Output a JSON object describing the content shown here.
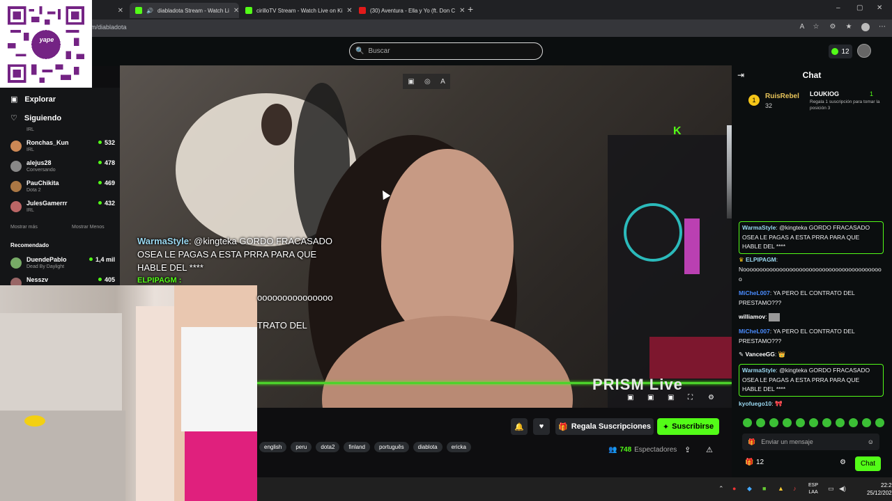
{
  "browser": {
    "tabs": [
      {
        "title": "diabladota Stream - Watch Li",
        "color": "#53fc18"
      },
      {
        "title": "cirilloTV Stream - Watch Live on Ki",
        "color": "#53fc18"
      },
      {
        "title": "(30) Aventura - Ella y Yo (ft. Don C",
        "color": "#e21a1a"
      }
    ],
    "partial_tab": "d",
    "new_tab": "+",
    "url": "m/diabladota",
    "window": {
      "minimize": "–",
      "maximize": "▢",
      "close": "✕"
    }
  },
  "header": {
    "search_placeholder": "Buscar",
    "notif_count": "12"
  },
  "qr": {
    "brand": "yape",
    "brand_color": "#742384"
  },
  "sidebar": {
    "nav": [
      {
        "label": "Explorar",
        "icon": "compass-icon"
      },
      {
        "label": "Siguiendo",
        "icon": "heart-icon"
      }
    ],
    "partial_sub": "IRL",
    "channels": [
      {
        "name": "Ronchas_Kun",
        "sub": "IRL",
        "viewers": "532",
        "color": "#c85"
      },
      {
        "name": "alejus28",
        "sub": "Conversando",
        "viewers": "478",
        "color": "#888"
      },
      {
        "name": "PauChikita",
        "sub": "Dota 2",
        "viewers": "469",
        "color": "#a74"
      },
      {
        "name": "JulesGamerrr",
        "sub": "IRL",
        "viewers": "432",
        "color": "#b66"
      }
    ],
    "show_more": "Mostrar más",
    "show_less": "Mostrar Menos",
    "recommended_heading": "Recomendado",
    "recommended": [
      {
        "name": "DuendePablo",
        "sub": "Dead By Daylight",
        "viewers": "1,4 mil",
        "color": "#7a6"
      },
      {
        "name": "Nesszv",
        "sub": "",
        "viewers": "405",
        "color": "#966"
      }
    ]
  },
  "video": {
    "overlay_chat": {
      "user": "WarmaStyle",
      "text": ": @kingteka GORDO FRACASADO OSEA LE PAGAS A ESTA PRRA PARA QUE HABLE DEL ****",
      "user2": "ELPIPAGM :",
      "line3": "ooooooooooooooo",
      "line4": "TRATO DEL"
    },
    "watermark": "PRISM Live",
    "kick_mark": "K"
  },
  "actions": {
    "gift_label": "Regala Suscripciones",
    "subscribe_label": "Suscribirse"
  },
  "tags": [
    "english",
    "peru",
    "dota2",
    "finland",
    "português",
    "diablota",
    "ericka"
  ],
  "viewers": {
    "count": "748",
    "label": "Espectadores"
  },
  "chat": {
    "title": "Chat",
    "top_gifter": {
      "name": "RuisRebel",
      "count": "32"
    },
    "second_gifter": {
      "name": "LOUKIOG",
      "count": "1",
      "sub": "Regala 1 suscripción para tomar la posición 3"
    },
    "messages": [
      {
        "user": "WarmaStyle",
        "text": ": @kingteka GORDO FRACASADO OSEA LE PAGAS A ESTA PRRA PARA QUE HABLE DEL ****",
        "color": "#9ad8f0",
        "hl": true
      },
      {
        "user": "ELPIPAGM",
        "text": ":",
        "color": "#9ad8f0",
        "hl": false
      },
      {
        "user": "",
        "text": "Nooooooooooooooooooooooooooooooooooooooooooo",
        "color": "#fff",
        "hl": false
      },
      {
        "user": "MiCheL007",
        "text": ": YA PERO EL CONTRATO DEL PRESTAMO???",
        "color": "#4a8cff",
        "hl": false
      },
      {
        "user": "williamov",
        "text": ":",
        "color": "#fff",
        "hl": false
      },
      {
        "user": "MiCheL007",
        "text": ": YA PERO EL CONTRATO DEL PRESTAMO???",
        "color": "#4a8cff",
        "hl": false
      },
      {
        "user": "VanceeGG",
        "text": ":",
        "color": "#fff",
        "hl": false
      },
      {
        "user": "WarmaStyle",
        "text": ": @kingteka GORDO FRACASADO OSEA LE PAGAS A ESTA PRRA PARA QUE HABLE DEL ****",
        "color": "#9ad8f0",
        "hl": true
      },
      {
        "user": "kyofuego10",
        "text": ":",
        "color": "#9ad8f0",
        "hl": false
      }
    ],
    "input_placeholder": "Enviar un mensaje",
    "points": "12",
    "send_label": "Chat"
  },
  "taskbar": {
    "lang_top": "ESP",
    "lang_bottom": "LAA",
    "time": "22:29",
    "date": "25/12/2025"
  }
}
